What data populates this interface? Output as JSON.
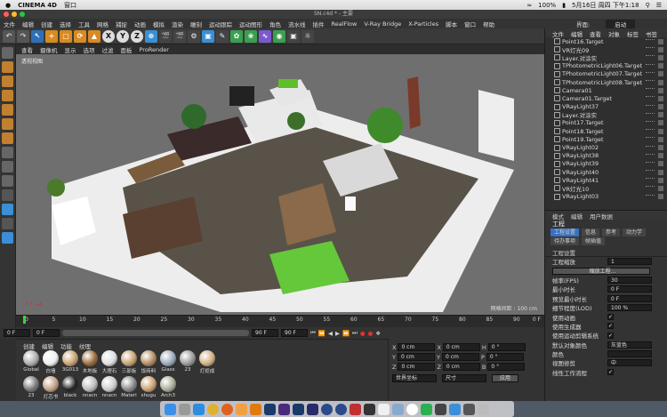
{
  "mac": {
    "apple": "",
    "app": "CINEMA 4D",
    "window": "窗口",
    "battery": "100%",
    "date": "5月16日 周四 下午1:18"
  },
  "window_title": "SN.c4d * - 主要",
  "menus": [
    "文件",
    "编辑",
    "创建",
    "选择",
    "工具",
    "网格",
    "捕捉",
    "动画",
    "模拟",
    "渲染",
    "雕刻",
    "运动跟踪",
    "运动图形",
    "角色",
    "流水线",
    "插件",
    "RealFlow",
    "V-Ray Bridge",
    "X-Particles",
    "脚本",
    "窗口",
    "帮助"
  ],
  "layout": {
    "label": "界面:",
    "value": "启动"
  },
  "view_menu": [
    "查看",
    "摄像机",
    "显示",
    "选项",
    "过滤",
    "面板",
    "ProRender"
  ],
  "viewport": {
    "label": "透视视图",
    "grid": "网格间距 : 100 cm"
  },
  "timeline": {
    "ticks": [
      "0",
      "5",
      "10",
      "15",
      "20",
      "25",
      "30",
      "35",
      "40",
      "45",
      "50",
      "55",
      "60",
      "65",
      "70",
      "75",
      "80",
      "85",
      "90"
    ],
    "end": "0 F"
  },
  "timebar": {
    "start": "0 F",
    "current": "0 F",
    "end": "90 F",
    "end2": "90 F"
  },
  "materials": {
    "menu": [
      "创建",
      "编辑",
      "功能",
      "纹理"
    ],
    "items": [
      "Global",
      "白墙",
      "3G013",
      "木地板",
      "大理石",
      "三部板",
      "饭砖料",
      "Glass",
      "23",
      "灯炬成",
      "23",
      "灯芯书",
      "black",
      "nnacn",
      "nnacn",
      "Materi",
      "shugu",
      "Arch3"
    ]
  },
  "coords": {
    "rows": [
      [
        "X",
        "0 cm",
        "X",
        "0 cm",
        "H",
        "0 °"
      ],
      [
        "Y",
        "0 cm",
        "Y",
        "0 cm",
        "P",
        "0 °"
      ],
      [
        "Z",
        "0 cm",
        "Z",
        "0 cm",
        "B",
        "0 °"
      ]
    ],
    "mode": "世界坐标",
    "size": "尺寸",
    "apply": "应用"
  },
  "obj_menu": [
    "文件",
    "编辑",
    "查看",
    "对象",
    "标签",
    "书签"
  ],
  "objects": [
    "Point16.Target",
    "VR灯光09",
    "Layer.对涂实",
    "TPhotometricLight06.Target",
    "TPhotometricLight07.Target",
    "TPhotometricLight08.Target",
    "Camera01",
    "Camera01.Target",
    "VRayLight37",
    "Layer.对涂实",
    "Point17.Target",
    "Point18.Target",
    "Point19.Target",
    "VRayLight02",
    "VRayLight38",
    "VRayLight39",
    "VRayLight40",
    "VRayLight41",
    "VR灯光10",
    "VRayLight03"
  ],
  "attr": {
    "menu": [
      "模式",
      "编辑",
      "用户数据"
    ],
    "title": "工程",
    "tabs1": [
      "工程设置",
      "信息",
      "参考",
      "动力学"
    ],
    "tabs2": [
      "待办事项",
      "帧插值"
    ],
    "section": "工程设置",
    "rows": [
      {
        "label": "工程缩放",
        "value": "1"
      },
      {
        "label": "",
        "value": "缩放工程..."
      },
      {
        "label": "帧率(FPS)",
        "value": "30"
      },
      {
        "label": "最小时长",
        "value": "0 F"
      },
      {
        "label": "预览最小时长",
        "value": "0 F"
      },
      {
        "label": "细节程度(LOD)",
        "value": "100 %"
      },
      {
        "label": "使用动画",
        "check": "✓"
      },
      {
        "label": "使用生成器",
        "check": "✓"
      },
      {
        "label": "使用运动剪辑系统",
        "check": "✓"
      },
      {
        "label": "默认对象颜色",
        "value": "灰蓝色"
      },
      {
        "label": "颜色",
        "value": ""
      },
      {
        "label": "视图修剪",
        "value": "中"
      },
      {
        "label": "线性工作流程",
        "check": "✓"
      }
    ]
  }
}
